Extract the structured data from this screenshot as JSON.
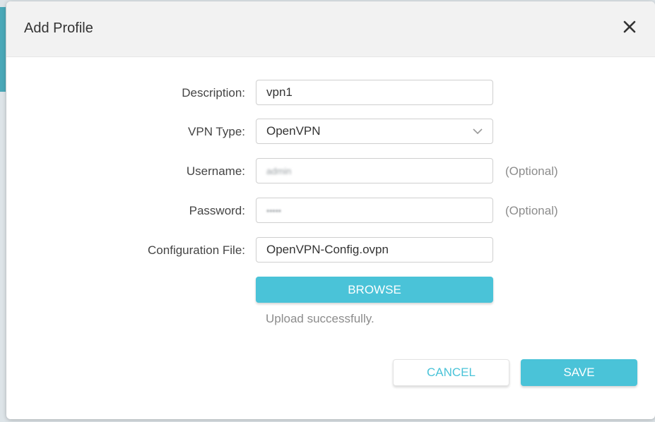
{
  "dialog": {
    "title": "Add Profile",
    "close_icon": "close-icon"
  },
  "form": {
    "description": {
      "label": "Description:",
      "value": "vpn1"
    },
    "vpn_type": {
      "label": "VPN Type:",
      "value": "OpenVPN",
      "icon": "chevron-down-icon"
    },
    "username": {
      "label": "Username:",
      "value": "admin",
      "hint": "(Optional)"
    },
    "password": {
      "label": "Password:",
      "value": "•••••",
      "hint": "(Optional)"
    },
    "config_file": {
      "label": "Configuration File:",
      "value": "OpenVPN-Config.ovpn"
    }
  },
  "browse": {
    "label": "BROWSE"
  },
  "upload_status": "Upload successfully.",
  "actions": {
    "cancel": "CANCEL",
    "save": "SAVE"
  },
  "colors": {
    "accent": "#4ac3d8",
    "header_bg": "#f2f2f2",
    "label_text": "#444444",
    "hint_text": "#8c8c8c"
  }
}
